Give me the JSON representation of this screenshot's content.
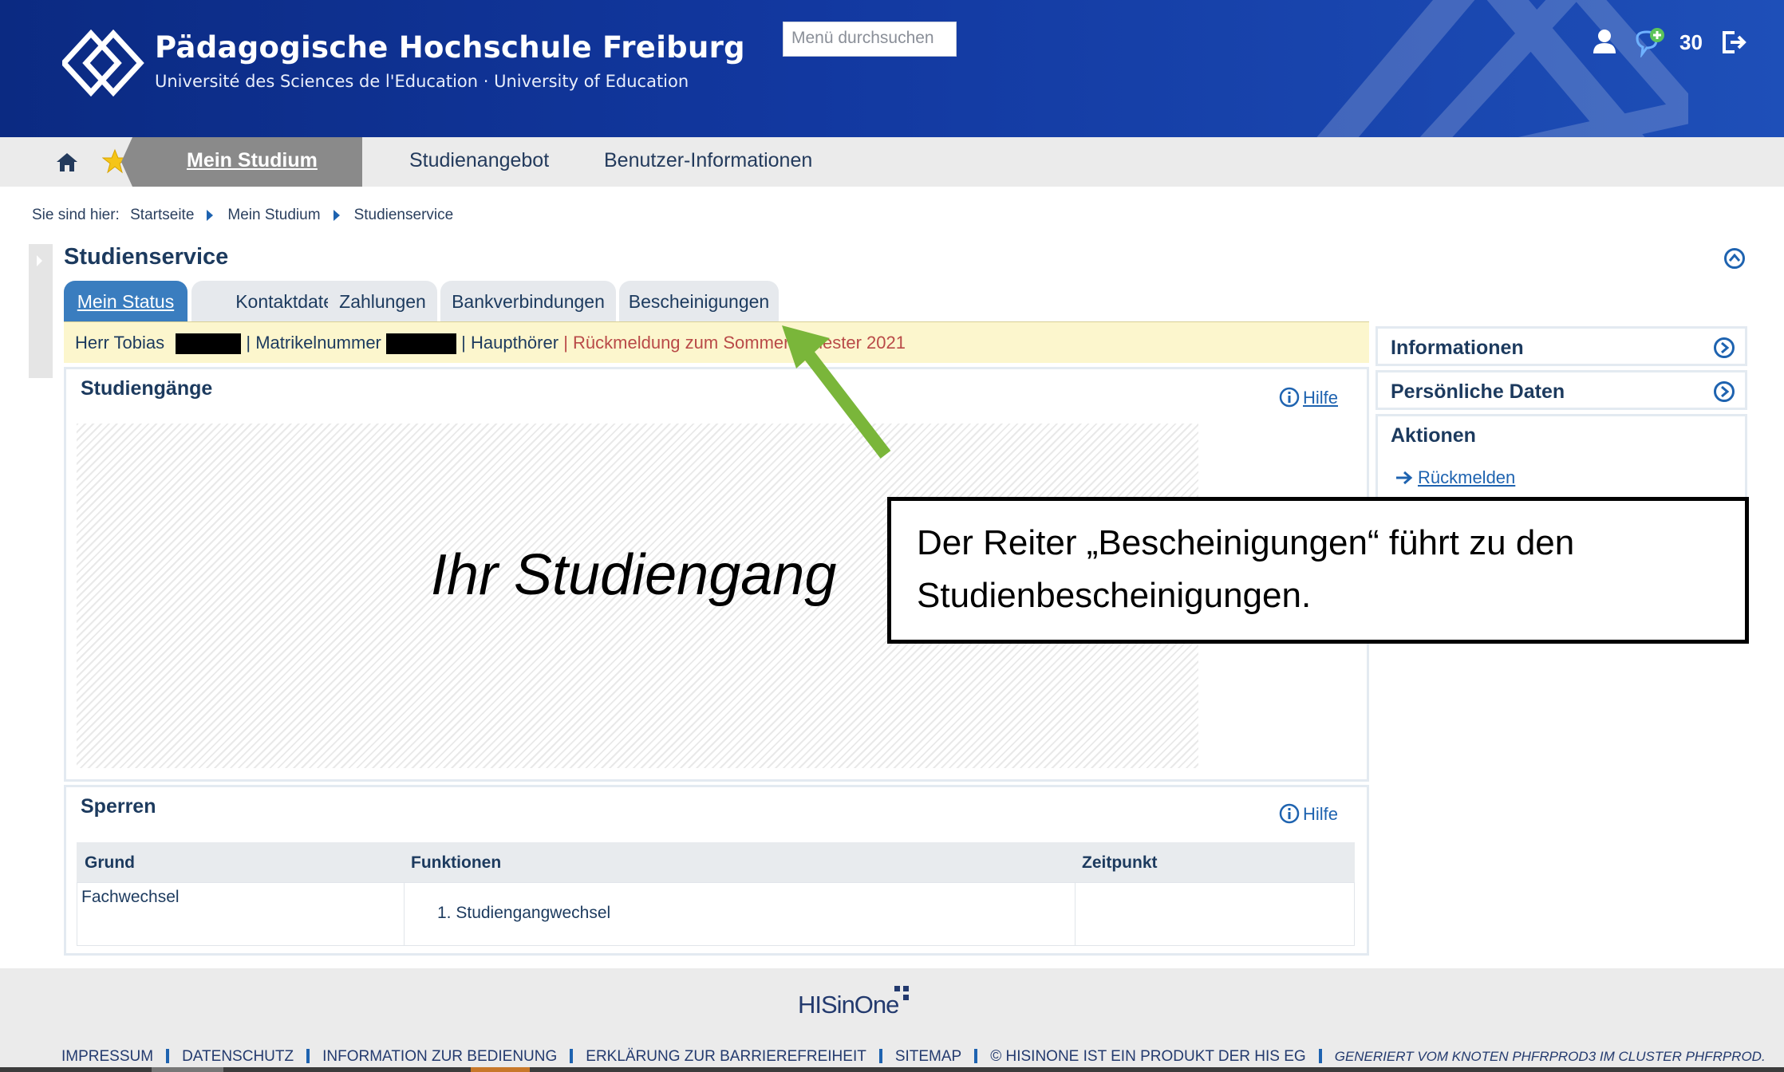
{
  "header": {
    "title": "Pädagogische Hochschule Freiburg",
    "subtitle": "Université des Sciences de l'Education · University of Education",
    "search_placeholder": "Menü durchsuchen",
    "notification_count": "30",
    "icons": [
      "user-icon",
      "chat-add-icon",
      "logout-icon"
    ]
  },
  "nav": {
    "items": [
      {
        "label": "Mein Studium",
        "active": true
      },
      {
        "label": "Studienangebot"
      },
      {
        "label": "Benutzer-Informationen"
      }
    ],
    "icons": [
      "home-icon",
      "star-icon"
    ]
  },
  "breadcrumb": {
    "prefix": "Sie sind hier:",
    "items": [
      "Startseite",
      "Mein Studium",
      "Studienservice"
    ]
  },
  "page": {
    "title": "Studienservice",
    "tabs": [
      "Mein Status",
      "Kontaktdaten",
      "Zahlungen",
      "Bankverbindungen",
      "Bescheinigungen"
    ],
    "active_tab": "Mein Status"
  },
  "status": {
    "salutation": "Herr Tobias",
    "matrikel_label": "Matrikelnummer",
    "role": "Haupthörer",
    "warning": "Rückmeldung zum Sommersemester 2021"
  },
  "studiengaenge": {
    "title": "Studiengänge",
    "help": "Hilfe",
    "placeholder_text": "Ihr Studiengang"
  },
  "sperren": {
    "title": "Sperren",
    "help": "Hilfe",
    "columns": [
      "Grund",
      "Funktionen",
      "Zeitpunkt"
    ],
    "rows": [
      {
        "grund": "Fachwechsel",
        "funktionen": "1. Studiengangwechsel",
        "zeitpunkt": ""
      }
    ]
  },
  "right": {
    "informationen": "Informationen",
    "persoenliche_daten": "Persönliche Daten",
    "aktionen": "Aktionen",
    "action_link": "Rückmelden"
  },
  "annotation": {
    "line1": "Der Reiter „Bescheinigungen“ führt zu den",
    "line2": "Studienbescheinigungen.",
    "arrow_color": "#7ab63a"
  },
  "footer": {
    "logo": "HISinOne",
    "links": [
      "IMPRESSUM",
      "DATENSCHUTZ",
      "INFORMATION ZUR BEDIENUNG",
      "ERKLÄRUNG ZUR BARRIEREFREIHEIT",
      "SITEMAP",
      "© HISINONE IST EIN PRODUKT DER HIS EG"
    ],
    "generated": "GENERIERT VOM KNOTEN PHFRPROD3 IM CLUSTER PHFRPROD."
  },
  "colors": {
    "header_blue": "#1238a0",
    "tab_active": "#3a7dbf",
    "status_bg": "#fcf6cd",
    "warning_red": "#b94a48",
    "link_blue": "#1e63b0"
  }
}
